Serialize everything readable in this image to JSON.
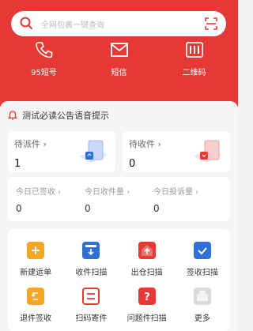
{
  "search": {
    "placeholder": "全网包裹一键查询"
  },
  "quick": [
    {
      "label": "95短号",
      "icon": "phone-icon"
    },
    {
      "label": "短信",
      "icon": "mail-icon"
    },
    {
      "label": "二维码",
      "icon": "qrcode-icon"
    }
  ],
  "notice": {
    "text": "测试必读公告语音提示"
  },
  "stats": [
    {
      "label": "待派件 ›",
      "value": "1"
    },
    {
      "label": "待收件 ›",
      "value": "0"
    }
  ],
  "daily": [
    {
      "label": "今日已签收 ›",
      "value": "0"
    },
    {
      "label": "今日收件量 ›",
      "value": "0"
    },
    {
      "label": "今日投诉量 ›",
      "value": "0"
    }
  ],
  "grid": [
    {
      "label": "新建运单",
      "icon": "new-waybill-icon",
      "color": "#f5a623"
    },
    {
      "label": "收件扫描",
      "icon": "receive-scan-icon",
      "color": "#2f6fd6"
    },
    {
      "label": "出仓扫描",
      "icon": "outbound-scan-icon",
      "color": "#e53935"
    },
    {
      "label": "签收扫描",
      "icon": "sign-scan-icon",
      "color": "#2f6fd6"
    },
    {
      "label": "退件签收",
      "icon": "return-sign-icon",
      "color": "#f5a623"
    },
    {
      "label": "扫码寄件",
      "icon": "scan-send-icon",
      "color": "#e53935"
    },
    {
      "label": "问题件扫描",
      "icon": "problem-scan-icon",
      "color": "#e53935"
    },
    {
      "label": "更多",
      "icon": "more-icon",
      "color": "#cfcfcf"
    }
  ],
  "colors": {
    "brand": "#e53935",
    "blue": "#2f6fd6",
    "orange": "#f5a623"
  }
}
